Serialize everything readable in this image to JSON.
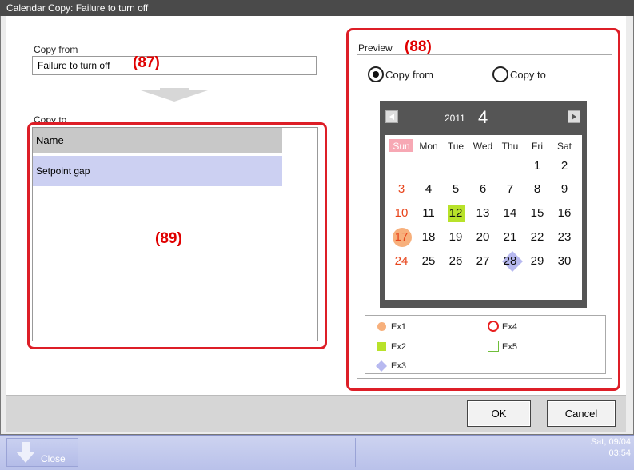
{
  "window": {
    "title": "Calendar Copy: Failure to turn off"
  },
  "copy_from": {
    "label": "Copy from",
    "value": "Failure to turn off"
  },
  "copy_to": {
    "label": "Copy to",
    "column_header": "Name",
    "rows": [
      "Setpoint gap"
    ]
  },
  "annotations": {
    "a87": "(87)",
    "a88": "(88)",
    "a89": "(89)"
  },
  "preview": {
    "label": "Preview",
    "radio_copy_from": "Copy from",
    "radio_copy_to": "Copy to",
    "selected": "copy_from"
  },
  "calendar": {
    "year": "2011",
    "month": "4",
    "weekdays": [
      "Sun",
      "Mon",
      "Tue",
      "Wed",
      "Thu",
      "Fri",
      "Sat"
    ],
    "weeks": [
      [
        "",
        "",
        "",
        "",
        "",
        "1",
        "2"
      ],
      [
        "3",
        "4",
        "5",
        "6",
        "7",
        "8",
        "9"
      ],
      [
        "10",
        "11",
        "12",
        "13",
        "14",
        "15",
        "16"
      ],
      [
        "17",
        "18",
        "19",
        "20",
        "21",
        "22",
        "23"
      ],
      [
        "24",
        "25",
        "26",
        "27",
        "28",
        "29",
        "30"
      ]
    ],
    "marked_days": {
      "ex1": "17",
      "ex2": "12",
      "ex3": "28"
    }
  },
  "legend": {
    "ex1": "Ex1",
    "ex2": "Ex2",
    "ex3": "Ex3",
    "ex4": "Ex4",
    "ex5": "Ex5"
  },
  "footer": {
    "ok_label": "OK",
    "cancel_label": "Cancel"
  },
  "taskbar": {
    "close_label": "Close",
    "date": "Sat, 09/04",
    "time": "03:54"
  },
  "colors": {
    "annotation_red": "#dd1e27",
    "sunday_red": "#e8451c",
    "ex1_orange": "#f7b07c",
    "ex2_green": "#b8e22a",
    "ex3_lavender": "#b7b9f0",
    "ex4_red": "#e81e1e",
    "ex5_green": "#6fbe3a",
    "selection_row": "#ccd0f2"
  }
}
